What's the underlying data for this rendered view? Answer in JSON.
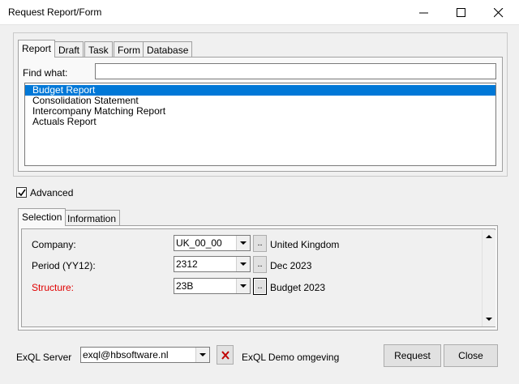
{
  "window": {
    "title": "Request Report/Form"
  },
  "top_tabs": [
    "Report",
    "Draft",
    "Task",
    "Form",
    "Database"
  ],
  "find": {
    "label": "Find what:",
    "value": ""
  },
  "report_list": {
    "items": [
      "Budget Report",
      "Consolidation Statement",
      "Intercompany Matching Report",
      "Actuals Report"
    ],
    "selected_index": 0
  },
  "advanced": {
    "label": "Advanced",
    "checked": true
  },
  "sub_tabs": [
    "Selection",
    "Information"
  ],
  "selection": {
    "company": {
      "label": "Company:",
      "value": "UK_00_00",
      "description": "United Kingdom",
      "button": ".."
    },
    "period": {
      "label": "Period (YY12):",
      "value": "2312",
      "description": "Dec 2023",
      "button": ".."
    },
    "structure": {
      "label": "Structure:",
      "value": "23B",
      "description": "Budget 2023",
      "button": "..",
      "label_color": "#e00000"
    }
  },
  "server": {
    "label": "ExQL Server",
    "value": "exql@hbsoftware.nl",
    "description": "ExQL Demo omgeving"
  },
  "buttons": {
    "request": "Request",
    "close": "Close"
  },
  "colors": {
    "selection_highlight": "#0078d7",
    "required_label": "#e00000",
    "delete_icon": "#c00000"
  }
}
